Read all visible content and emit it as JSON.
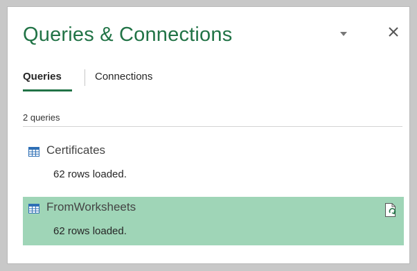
{
  "pane": {
    "title": "Queries & Connections",
    "dropdown_icon": "caret-down-icon",
    "close_icon": "close-icon"
  },
  "tabs": [
    {
      "label": "Queries",
      "active": true
    },
    {
      "label": "Connections",
      "active": false
    }
  ],
  "query_count_label": "2 queries",
  "queries": [
    {
      "name": "Certificates",
      "status": "62 rows loaded.",
      "icon": "table-icon",
      "selected": false
    },
    {
      "name": "FromWorksheets",
      "status": "62 rows loaded.",
      "icon": "table-icon",
      "selected": true,
      "action_icon": "refresh-file-icon"
    }
  ],
  "colors": {
    "accent": "#217346",
    "selected_row": "#9fd5b7",
    "table_icon": "#2e6fb5"
  }
}
